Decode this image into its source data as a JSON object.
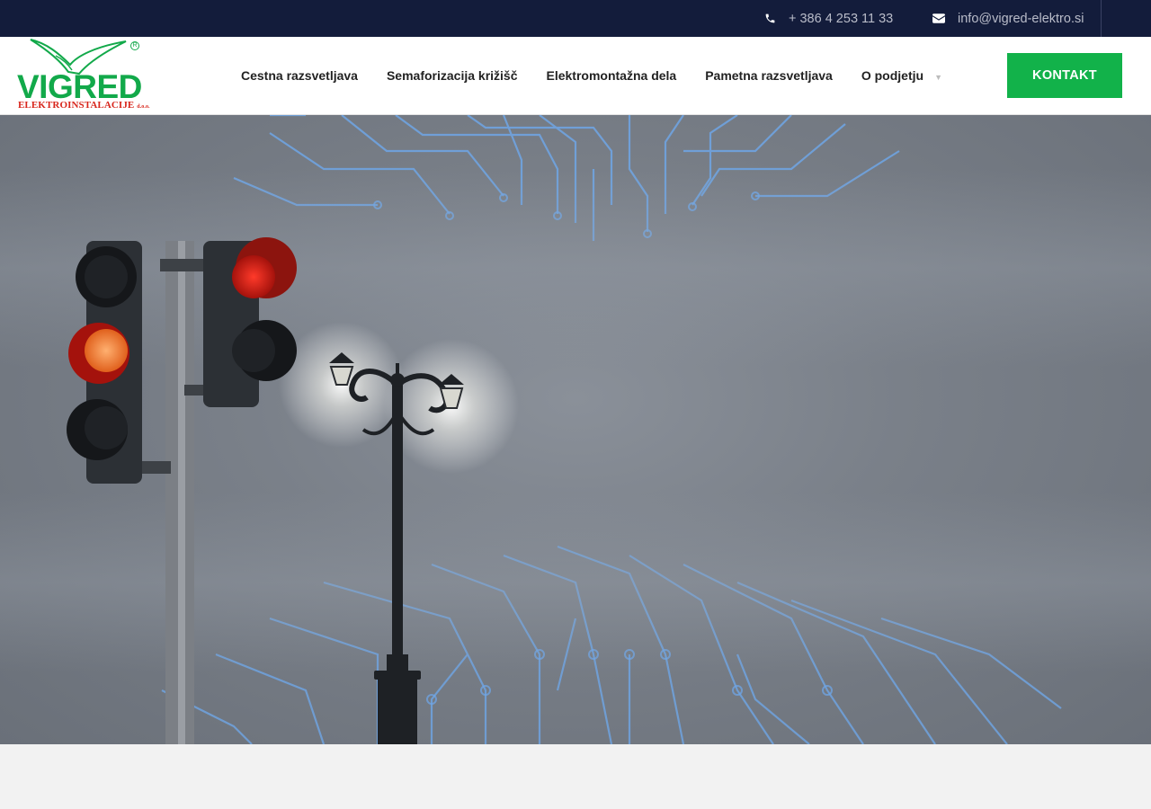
{
  "topbar": {
    "phone": "+ 386 4 253 11 33",
    "email": "info@vigred-elektro.si",
    "phone_icon": "phone-icon",
    "email_icon": "envelope-icon"
  },
  "logo": {
    "brand": "VIGRED",
    "subtitle": "ELEKTROINSTALACIJE",
    "suffix": "d.o.o.",
    "registered": "R",
    "brand_color": "#12a94a",
    "subtitle_color": "#d8261c"
  },
  "nav": {
    "items": [
      {
        "label": "Cestna razsvetljava"
      },
      {
        "label": "Semaforizacija križišč"
      },
      {
        "label": "Elektromontažna dela"
      },
      {
        "label": "Pametna razsvetljava"
      },
      {
        "label": "O podjetju"
      }
    ],
    "caret": "▼"
  },
  "cta": {
    "label": "KONTAKT",
    "color": "#12b24a"
  },
  "colors": {
    "topbar": "#131c3b",
    "accent": "#12b24a"
  }
}
